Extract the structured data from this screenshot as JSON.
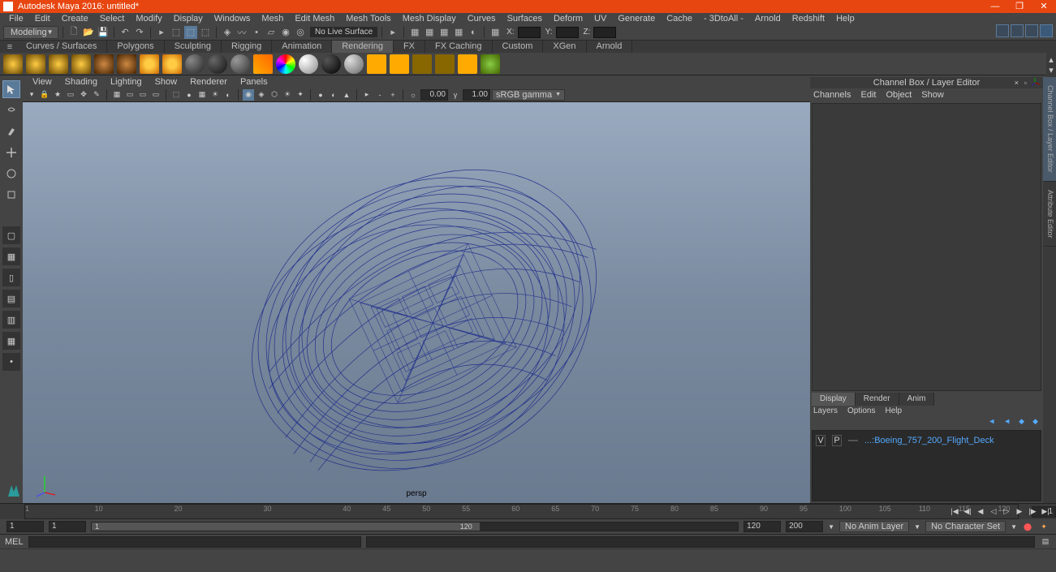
{
  "app": {
    "title": "Autodesk Maya 2016: untitled*"
  },
  "menus": [
    "File",
    "Edit",
    "Create",
    "Select",
    "Modify",
    "Display",
    "Windows",
    "Mesh",
    "Edit Mesh",
    "Mesh Tools",
    "Mesh Display",
    "Curves",
    "Surfaces",
    "Deform",
    "UV",
    "Generate",
    "Cache",
    "- 3DtoAll -",
    "Arnold",
    "Redshift",
    "Help"
  ],
  "workspace": "Modeling",
  "status_text": "No Live Surface",
  "xyz": {
    "x": "X:",
    "y": "Y:",
    "z": "Z:"
  },
  "shelf_tabs": [
    "Curves / Surfaces",
    "Polygons",
    "Sculpting",
    "Rigging",
    "Animation",
    "Rendering",
    "FX",
    "FX Caching",
    "Custom",
    "XGen",
    "Arnold"
  ],
  "shelf_active": "Rendering",
  "panel_menus": [
    "View",
    "Shading",
    "Lighting",
    "Show",
    "Renderer",
    "Panels"
  ],
  "panel_vals": {
    "exposure": "0.00",
    "gamma": "1.00",
    "colorspace": "sRGB gamma"
  },
  "camera": "persp",
  "channel_title": "Channel Box / Layer Editor",
  "channel_menus": [
    "Channels",
    "Edit",
    "Object",
    "Show"
  ],
  "layer_tabs": [
    "Display",
    "Render",
    "Anim"
  ],
  "layer_menus": [
    "Layers",
    "Options",
    "Help"
  ],
  "layer_item": {
    "v": "V",
    "p": "P",
    "name": "...:Boeing_757_200_Flight_Deck"
  },
  "vtabs": [
    "Channel Box / Layer Editor",
    "Attribute Editor"
  ],
  "time_ticks": [
    "1",
    "10",
    "20",
    "30",
    "40",
    "45",
    "50",
    "55",
    "60",
    "65",
    "70",
    "75",
    "80",
    "85",
    "90",
    "95",
    "100",
    "105",
    "110",
    "115",
    "120"
  ],
  "range": {
    "start_out": "1",
    "start_in": "1",
    "end_in": "120",
    "end_out": "120",
    "anim_end": "200"
  },
  "anim_layer": "No Anim Layer",
  "char_set": "No Character Set",
  "cmd_lang": "MEL",
  "range_label_left": "1",
  "range_label_right": "120"
}
